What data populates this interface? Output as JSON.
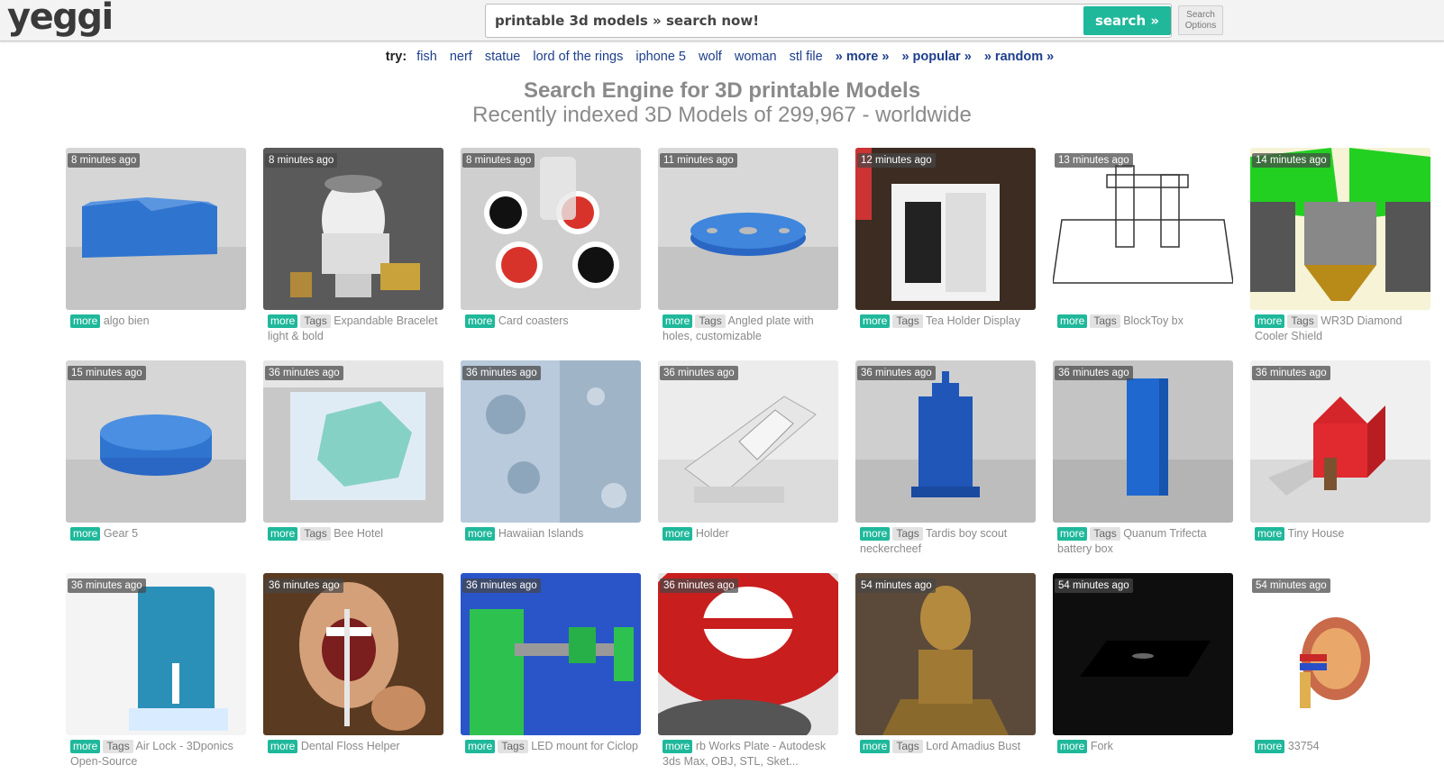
{
  "header": {
    "logo": "yeggi",
    "search_value": "printable 3d models » search now!",
    "search_button": "search »",
    "options_line1": "Search",
    "options_line2": "Options"
  },
  "try": {
    "label": "try:",
    "links": [
      "fish",
      "nerf",
      "statue",
      "lord of the rings",
      "iphone 5",
      "wolf",
      "woman",
      "stl file"
    ],
    "more": "» more »",
    "popular": "» popular »",
    "random": "» random »"
  },
  "headline": "Search Engine for 3D printable Models",
  "subline": "Recently indexed 3D Models of 299,967 - worldwide",
  "badges": {
    "more": "more",
    "tags": "Tags"
  },
  "colors": {
    "accent": "#1fb89b",
    "link": "#1e3f8c",
    "heading": "#8a8a8a"
  },
  "items": [
    {
      "time": "8 minutes ago",
      "title": "algo bien",
      "tags": false
    },
    {
      "time": "8 minutes ago",
      "title": "Expandable Bracelet light & bold",
      "tags": true
    },
    {
      "time": "8 minutes ago",
      "title": "Card coasters",
      "tags": false
    },
    {
      "time": "11 minutes ago",
      "title": "Angled plate with holes, customizable",
      "tags": true
    },
    {
      "time": "12 minutes ago",
      "title": "Tea Holder Display",
      "tags": true
    },
    {
      "time": "13 minutes ago",
      "title": "BlockToy bx",
      "tags": true
    },
    {
      "time": "14 minutes ago",
      "title": "WR3D Diamond Cooler Shield",
      "tags": true
    },
    {
      "time": "15 minutes ago",
      "title": "Gear 5",
      "tags": false
    },
    {
      "time": "36 minutes ago",
      "title": "Bee Hotel",
      "tags": true
    },
    {
      "time": "36 minutes ago",
      "title": "Hawaiian Islands",
      "tags": false
    },
    {
      "time": "36 minutes ago",
      "title": "Holder",
      "tags": false
    },
    {
      "time": "36 minutes ago",
      "title": "Tardis boy scout neckercheef",
      "tags": true
    },
    {
      "time": "36 minutes ago",
      "title": "Quanum Trifecta battery box",
      "tags": true
    },
    {
      "time": "36 minutes ago",
      "title": "Tiny House",
      "tags": false
    },
    {
      "time": "36 minutes ago",
      "title": "Air Lock - 3Dponics Open-Source",
      "tags": true
    },
    {
      "time": "36 minutes ago",
      "title": "Dental Floss Helper",
      "tags": false
    },
    {
      "time": "36 minutes ago",
      "title": "LED mount for Ciclop",
      "tags": true
    },
    {
      "time": "36 minutes ago",
      "title": "rb Works Plate - Autodesk 3ds Max, OBJ, STL, Sket...",
      "tags": false
    },
    {
      "time": "54 minutes ago",
      "title": "Lord Amadius Bust",
      "tags": true
    },
    {
      "time": "54 minutes ago",
      "title": "Fork",
      "tags": false
    },
    {
      "time": "54 minutes ago",
      "title": "33754",
      "tags": false
    }
  ]
}
